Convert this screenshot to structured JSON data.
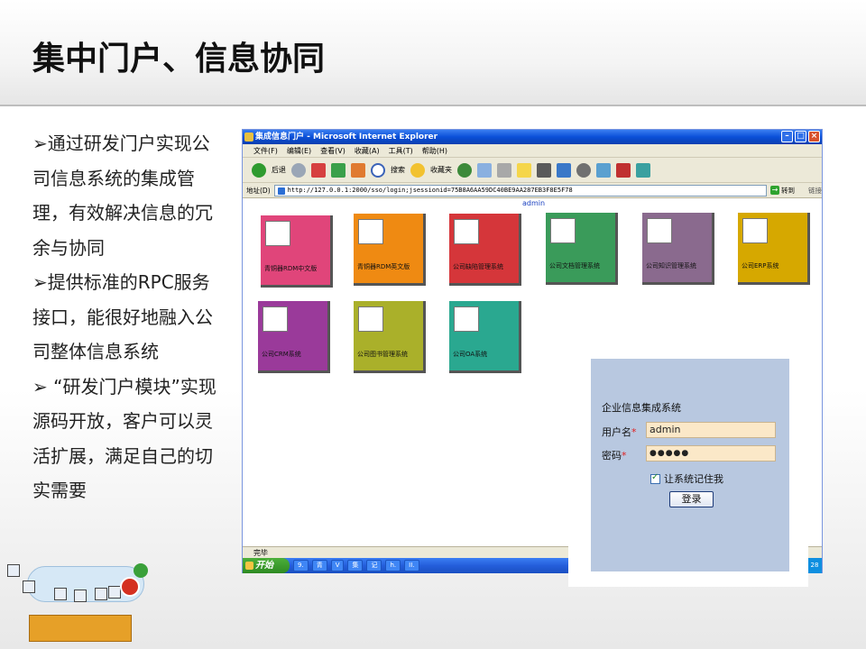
{
  "slide": {
    "title": "集中门户、信息协同",
    "bullets": [
      "➢通过研发门户实现公司信息系统的集成管理，有效解决信息的冗余与协同",
      "➢提供标准的RPC服务接口，能很好地融入公司整体信息系统",
      "➢ “研发门户模块”实现源码开放，客户可以灵活扩展，满足自己的切实需要"
    ]
  },
  "ie": {
    "title": "集成信息门户 - Microsoft Internet Explorer",
    "menu": [
      "文件(F)",
      "编辑(E)",
      "查看(V)",
      "收藏(A)",
      "工具(T)",
      "帮助(H)"
    ],
    "toolbar": {
      "back": "后退",
      "search": "搜索",
      "favorites": "收藏夹"
    },
    "address_label": "地址(D)",
    "address": "http://127.0.0.1:2000/sso/login;jsessionid=75B8A6AA59DC40BE9AA287EB3F8E5F78",
    "go": "转到",
    "links": "链接",
    "admin": "admin",
    "status": "完毕",
    "start": "开始"
  },
  "tiles": [
    {
      "label": "青铜器RDM中文版",
      "color": "#e0457a",
      "icon": "books-icon"
    },
    {
      "label": "青铜器RDM英文版",
      "color": "#ef8a12",
      "icon": "palette-icon"
    },
    {
      "label": "公司缺陷管理系统",
      "color": "#d5363a",
      "icon": "shapes-icon"
    },
    {
      "label": "公司文档管理系统",
      "color": "#3a9b5a",
      "icon": "folder-icon"
    },
    {
      "label": "公司知识管理系统",
      "color": "#8a6a8e",
      "icon": "document-user-icon"
    },
    {
      "label": "公司ERP系统",
      "color": "#d6a800",
      "icon": "globe-user-icon"
    },
    {
      "label": "公司CRM系统",
      "color": "#9a3a9a",
      "icon": "chart-icon"
    },
    {
      "label": "公司图书管理系统",
      "color": "#aab02a",
      "icon": "folder-icon"
    },
    {
      "label": "公司OA系统",
      "color": "#2aa890",
      "icon": "folder-icon"
    }
  ],
  "taskbar": [
    "9.",
    "青",
    "V",
    "集",
    "记",
    "h.",
    "II."
  ],
  "tray_time": "28",
  "login": {
    "title": "企业信息集成系统",
    "username_label": "用户名",
    "username_value": "admin",
    "password_label": "密码",
    "password_mask": "●●●●●",
    "remember_label": "让系统记住我",
    "submit": "登录"
  }
}
